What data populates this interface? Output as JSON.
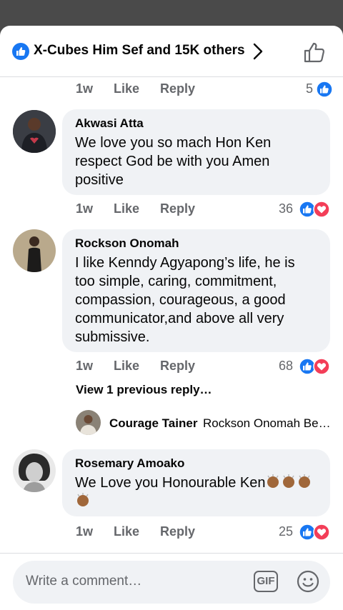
{
  "header": {
    "title": "X-Cubes Him Sef and 15K others"
  },
  "top_actions": {
    "time": "1w",
    "like": "Like",
    "reply": "Reply",
    "count": "5"
  },
  "comments": [
    {
      "name": "Akwasi Atta",
      "text": "We love you so mach Hon Ken respect God be with you Amen positive",
      "time": "1w",
      "like": "Like",
      "reply": "Reply",
      "count": "36"
    },
    {
      "name": "Rockson Onomah",
      "text": "I like Kenndy Agyapong’s life, he is too simple, caring, commitment, compassion, courageous, a good communicator,and above all very submissive.",
      "time": "1w",
      "like": "Like",
      "reply": "Reply",
      "count": "68"
    },
    {
      "name": "Rosemary Amoako",
      "text": "We Love you Honourable Ken",
      "time": "1w",
      "like": "Like",
      "reply": "Reply",
      "count": "25"
    }
  ],
  "view_previous": "View 1 previous reply…",
  "reply_preview": {
    "name": "Courage Tainer",
    "text": "Rockson Onomah Be…"
  },
  "composer": {
    "placeholder": "Write a comment…",
    "gif_label": "GIF"
  },
  "colors": {
    "facebook_blue": "#1877f2",
    "love_red": "#f33e58",
    "bubble_bg": "#f0f2f5",
    "muted": "#65676b"
  },
  "icons": {
    "header_like": "like-badge-icon",
    "chevron": "chevron-right-icon",
    "thumb": "thumbs-up-outline-icon",
    "reaction_like": "like-reaction-icon",
    "reaction_love": "love-reaction-icon",
    "clap": "clapping-hands-emoji",
    "emoji": "smiley-icon"
  }
}
